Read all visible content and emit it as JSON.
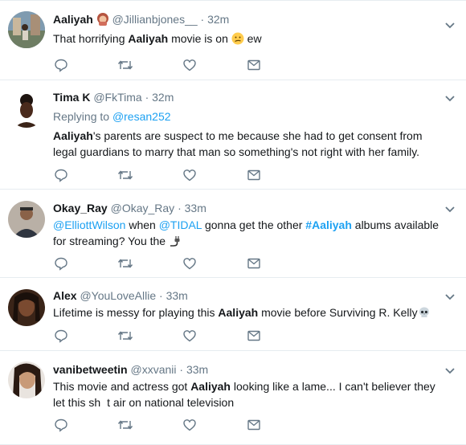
{
  "colors": {
    "accent": "#1da1f2",
    "secondary_text": "#657786",
    "primary_text": "#14171a",
    "divider": "#e6ecf0"
  },
  "tweets": [
    {
      "name": "Aaliyah",
      "name_emoji": "woman-emoji",
      "handle": "@Jillianbjones__",
      "separator": "·",
      "time": "32m",
      "text_parts": [
        "That horrifying ",
        "Aaliyah",
        " movie is on ",
        " ew"
      ],
      "inline_emoji": "confused-face-emoji"
    },
    {
      "name": "Tima K",
      "handle": "@FkTima",
      "separator": "·",
      "time": "32m",
      "reply_prefix": "Replying to ",
      "reply_handle": "@resan252",
      "text_parts": [
        "Aaliyah",
        "'s parents are suspect to me because she had to get consent from legal guardians to marry that man so something's not right with her family."
      ]
    },
    {
      "name": "Okay_Ray",
      "handle": "@Okay_Ray",
      "separator": "·",
      "time": "33m",
      "text_parts": [
        "@ElliottWilson",
        " when ",
        "@TIDAL",
        " gonna get the other ",
        "#Aaliyah",
        " albums available for streaming? You the "
      ],
      "inline_emoji": "plug-emoji"
    },
    {
      "name": "Alex",
      "handle": "@YouLoveAllie",
      "separator": "·",
      "time": "33m",
      "text_parts": [
        "Lifetime is messy for playing this ",
        "Aaliyah",
        " movie before Surviving R. Kelly"
      ],
      "inline_emoji": "skull-emoji"
    },
    {
      "name": "vanibetweetin",
      "handle": "@xxvanii",
      "separator": "·",
      "time": "33m",
      "text_parts": [
        "This movie and actress got ",
        "Aaliyah",
        " looking like a lame... I can't believer they let this sh",
        "t air on national television"
      ]
    }
  ]
}
